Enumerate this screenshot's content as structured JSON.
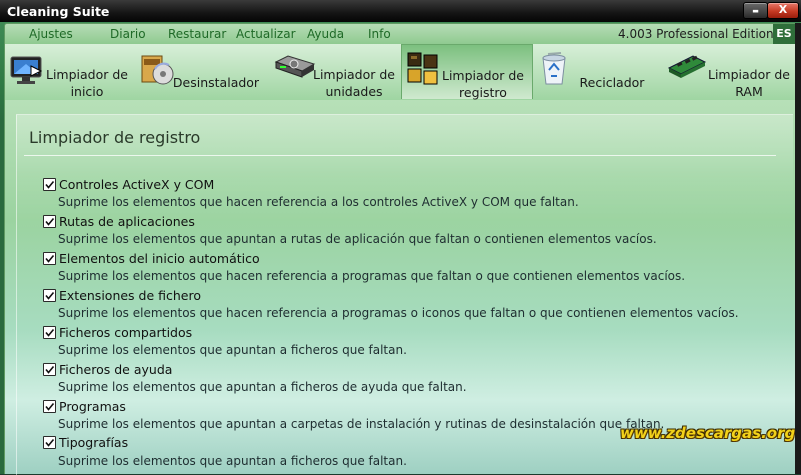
{
  "window": {
    "title": "Cleaning Suite",
    "minimize_glyph": "▬",
    "close_glyph": "X"
  },
  "menu": {
    "items": [
      "Ajustes",
      "Diario",
      "Restaurar",
      "Actualizar",
      "Ayuda",
      "Info"
    ],
    "edition": "4.003 Professional Edition",
    "language": "ES"
  },
  "tabs": [
    {
      "line1": "Limpiador de",
      "line2": "inicio",
      "icon": "monitor-icon"
    },
    {
      "line1": "Desinstalador",
      "line2": "",
      "icon": "cd-box-icon"
    },
    {
      "line1": "Limpiador de",
      "line2": "unidades",
      "icon": "hard-drive-icon"
    },
    {
      "line1": "Limpiador de",
      "line2": "registro",
      "icon": "registry-cubes-icon",
      "active": true
    },
    {
      "line1": "Reciclador",
      "line2": "",
      "icon": "recycle-bin-icon"
    },
    {
      "line1": "Limpiador de",
      "line2": "RAM",
      "icon": "ram-chip-icon"
    }
  ],
  "panel": {
    "title": "Limpiador de registro",
    "options": [
      {
        "label": "Controles ActiveX y COM",
        "desc": "Suprime los elementos que hacen referencia a los controles ActiveX y COM que faltan.",
        "checked": true
      },
      {
        "label": "Rutas de aplicaciones",
        "desc": "Suprime los elementos que apuntan a rutas de aplicación que faltan o contienen elementos vacíos.",
        "checked": true
      },
      {
        "label": "Elementos del inicio automático",
        "desc": "Suprime los elementos que hacen referencia a programas que faltan o que contienen elementos vacíos.",
        "checked": true
      },
      {
        "label": "Extensiones de fichero",
        "desc": "Suprime los elementos que hacen referencia a programas o iconos que faltan o que contienen elementos vacíos.",
        "checked": true
      },
      {
        "label": "Ficheros compartidos",
        "desc": "Suprime los elementos que apuntan a ficheros que faltan.",
        "checked": true
      },
      {
        "label": "Ficheros de ayuda",
        "desc": "Suprime los elementos que apuntan a ficheros de ayuda que faltan.",
        "checked": true
      },
      {
        "label": "Programas",
        "desc": "Suprime los elementos que apuntan a carpetas de instalación y rutinas de desinstalación que faltan.",
        "checked": true
      },
      {
        "label": "Tipografías",
        "desc": "Suprime los elementos que apuntan a ficheros que faltan.",
        "checked": true
      }
    ]
  },
  "watermark": "www.zdescargas.org",
  "colors": {
    "frame_green": "#2f7a44",
    "menu_text": "#1f6a27",
    "watermark": "#f2d21a"
  }
}
